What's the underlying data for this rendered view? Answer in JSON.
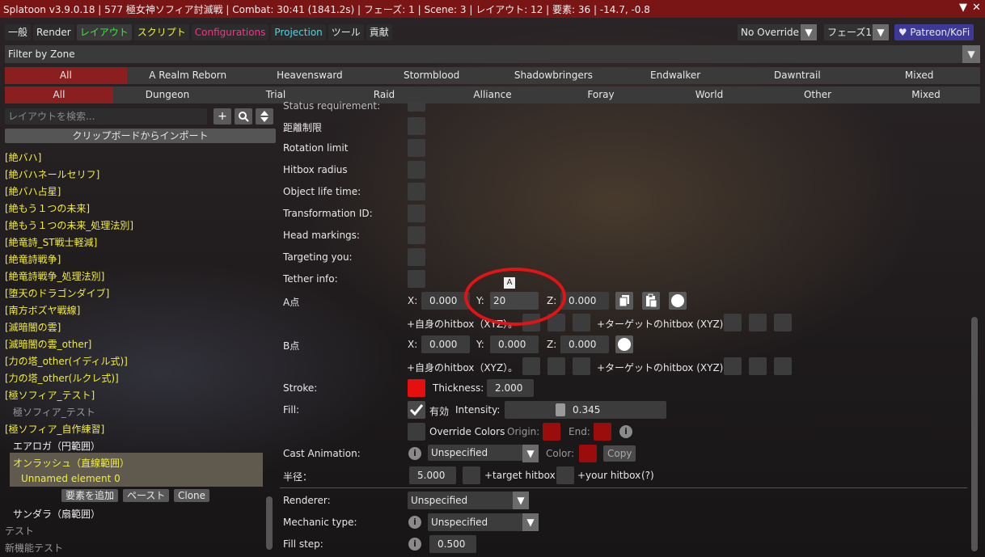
{
  "title": "Splatoon v3.9.0.18 | 577 極女神ソフィア討滅戦 | Combat: 30:41 (1841.2s) | フェーズ: 1 | Scene: 3 | レイアウト: 12 | 要素: 36 | -14.7, -0.8",
  "window_controls": {
    "collapse": "▼",
    "close": "✕"
  },
  "tabs": [
    {
      "label": "一般",
      "color": "#e8e8e8"
    },
    {
      "label": "Render",
      "color": "#e8e8e8"
    },
    {
      "label": "レイアウト",
      "color": "#3ee83e"
    },
    {
      "label": "スクリプト",
      "color": "#f2ee3c"
    },
    {
      "label": "Configurations",
      "color": "#ff2f8a"
    },
    {
      "label": "Projection",
      "color": "#42d9e8"
    },
    {
      "label": "ツール",
      "color": "#e8e8e8"
    },
    {
      "label": "貢献",
      "color": "#e8e8e8"
    }
  ],
  "override_dropdown": "No Override",
  "phase_dropdown": "フェーズ1",
  "patreon_label": "♥ Patreon/KoFi",
  "filter_label": "Filter by Zone",
  "expansions": [
    "All",
    "A Realm Reborn",
    "Heavensward",
    "Stormblood",
    "Shadowbringers",
    "Endwalker",
    "Dawntrail",
    "Mixed"
  ],
  "content_types": [
    "All",
    "Dungeon",
    "Trial",
    "Raid",
    "Alliance",
    "Foray",
    "World",
    "Other",
    "Mixed"
  ],
  "search_placeholder": "レイアウトを検索...",
  "import_button": "クリップボードからインポート",
  "layouts": [
    {
      "text": "[絶バハ]",
      "style": "y"
    },
    {
      "text": "[絶バハネールセリフ]",
      "style": "y"
    },
    {
      "text": "[絶バハ占星]",
      "style": "y"
    },
    {
      "text": "[絶もう１つの未来]",
      "style": "y"
    },
    {
      "text": "[絶もう１つの未来_処理法別]",
      "style": "y"
    },
    {
      "text": "[絶竜詩_ST戦士軽減]",
      "style": "y"
    },
    {
      "text": "[絶竜詩戦争]",
      "style": "y"
    },
    {
      "text": "[絶竜詩戦争_処理法別]",
      "style": "y"
    },
    {
      "text": "[堕天のドラゴンダイブ]",
      "style": "y"
    },
    {
      "text": "[南方ボズヤ戦線]",
      "style": "y"
    },
    {
      "text": "[滅暗闇の雲]",
      "style": "y"
    },
    {
      "text": "[滅暗闇の雲_other]",
      "style": "y"
    },
    {
      "text": "[力の塔_other(イディル式)]",
      "style": "y"
    },
    {
      "text": "[力の塔_other(ルクレ式)]",
      "style": "y"
    },
    {
      "text": "[極ソフィア_テスト]",
      "style": "y"
    },
    {
      "text": "極ソフィア_テスト",
      "style": "g",
      "indent": 10
    },
    {
      "text": "[極ソフィア_自作練習]",
      "style": "y"
    },
    {
      "text": "エアロガ（円範囲）",
      "style": "w",
      "indent": 10
    },
    {
      "text": "オンラッシュ（直線範囲）",
      "style": "y",
      "indent": 10
    },
    {
      "text": "Unnamed element 0",
      "style": "y",
      "indent": 20
    }
  ],
  "element_buttons": {
    "add": "要素を追加",
    "paste": "ペースト",
    "clone": "Clone"
  },
  "layouts_after": [
    {
      "text": "サンダラ（扇範囲）",
      "style": "w",
      "indent": 10
    },
    {
      "text": "テスト",
      "style": "g"
    },
    {
      "text": "新機能テスト",
      "style": "g"
    }
  ],
  "conditions": [
    "距離制限",
    "Rotation limit",
    "Hitbox radius",
    "Object life time:",
    "Transformation ID:",
    "Head markings:",
    "Targeting you:",
    "Tether info:"
  ],
  "status_requirement": "Status requirement:",
  "point_a": {
    "label": "A点",
    "x": "0.000",
    "y": "20",
    "z": "0.000"
  },
  "point_b": {
    "label": "B点",
    "x": "0.000",
    "y": "0.000",
    "z": "0.000"
  },
  "axis": {
    "x": "X:",
    "y": "Y:",
    "z": "Z:"
  },
  "hitbox_self": "+自身のhitbox（XYZ）。",
  "hitbox_target": "+ターゲットのhitbox (XYZ):",
  "ime_indicator": "A",
  "stroke": {
    "label": "Stroke:",
    "thickness_label": "Thickness:",
    "thickness": "2.000",
    "color": "#e60f0f"
  },
  "fill": {
    "label": "Fill:",
    "enabled_label": "有効",
    "intensity_label": "Intensity:",
    "intensity": "0.345",
    "intensity_value": 0.345
  },
  "override_colors": {
    "label": "Override Colors",
    "origin_label": "Origin:",
    "end_label": "End:",
    "origin_color": "#9b0d0d",
    "end_color": "#9b0d0d"
  },
  "cast_animation": {
    "label": "Cast Animation:",
    "value": "Unspecified",
    "color_label": "Color:",
    "color": "#9b0d0d",
    "copy_label": "Copy"
  },
  "radius": {
    "label": "半径：",
    "value": "5.000",
    "target_hitbox": "+target hitbox",
    "your_hitbox": "+your hitbox",
    "help": "(?)"
  },
  "renderer": {
    "label": "Renderer:",
    "value": "Unspecified"
  },
  "mechanic": {
    "label": "Mechanic type:",
    "value": "Unspecified"
  },
  "fill_step": {
    "label": "Fill step:",
    "value": "0.500"
  }
}
